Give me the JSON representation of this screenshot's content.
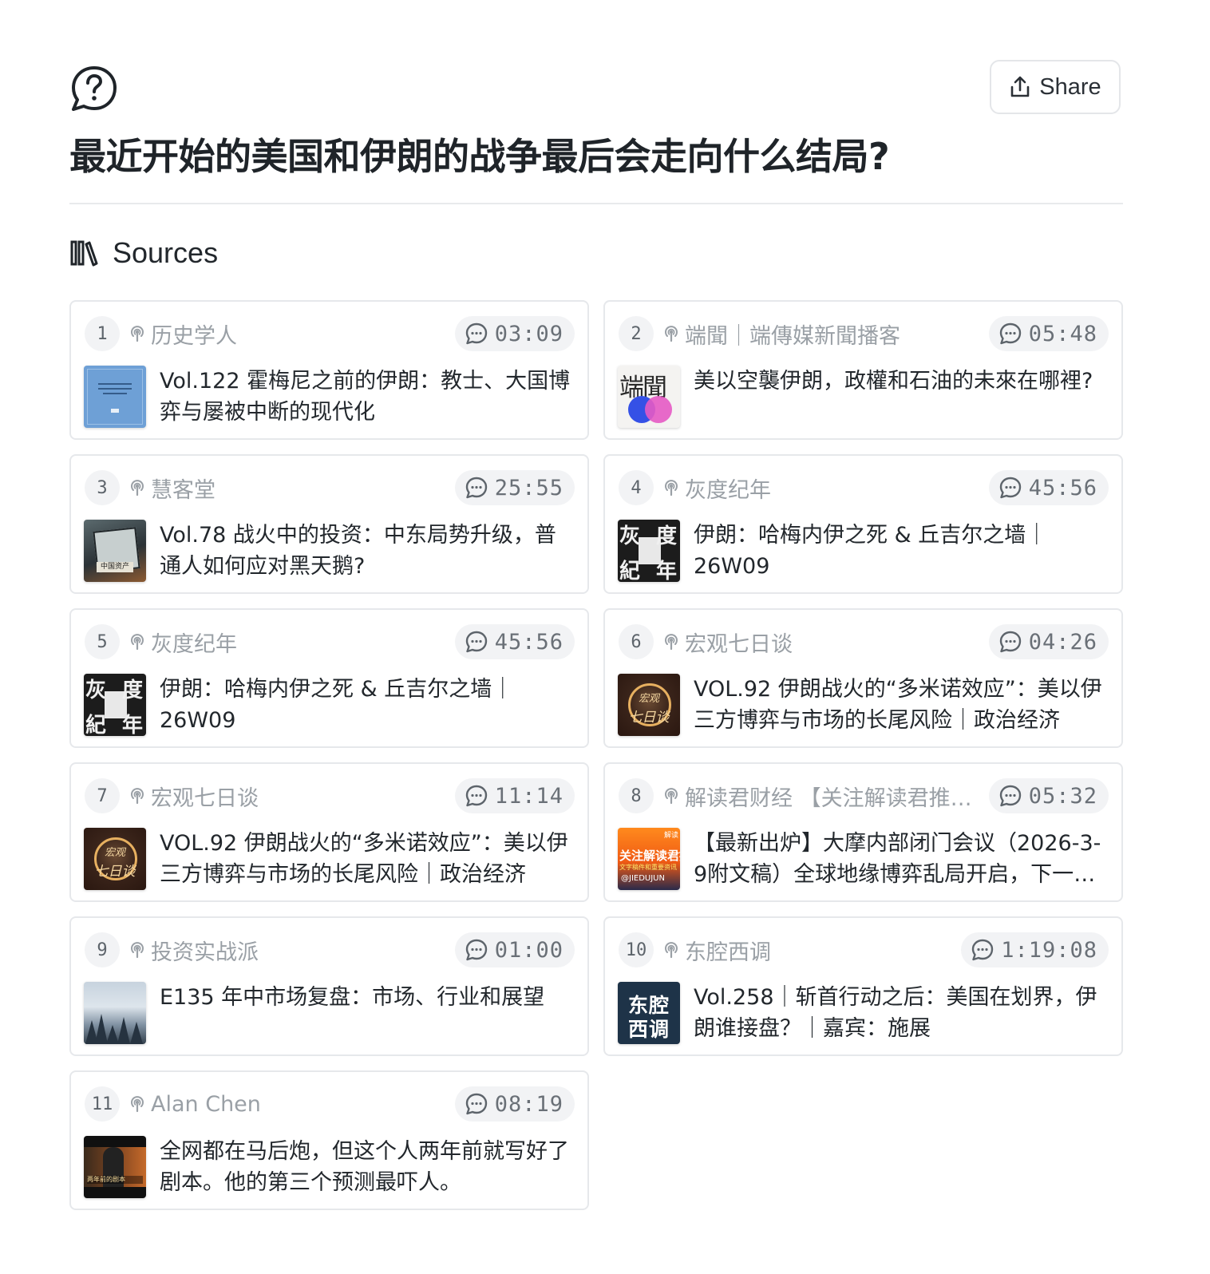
{
  "header": {
    "title": "最近开始的美国和伊朗的战争最后会走向什么结局?",
    "share_label": "Share",
    "question_icon": "question-chat-icon",
    "share_icon": "share-upload-icon"
  },
  "sources_section": {
    "label": "Sources",
    "icon": "library-books-icon"
  },
  "sources": [
    {
      "num": "1",
      "source": "历史学人",
      "duration": "03:09",
      "title": "Vol.122 霍梅尼之前的伊朗：教士、大国博弈与屡被中断的现代化",
      "thumb": "book-cover-blue"
    },
    {
      "num": "2",
      "source": "端聞｜端傳媒新聞播客",
      "duration": "05:48",
      "title": "美以空襲伊朗，政權和石油的未來在哪裡?",
      "thumb": "duan-logo",
      "thumb_text": "端聞"
    },
    {
      "num": "3",
      "source": "慧客堂",
      "duration": "25:55",
      "title": "Vol.78 战火中的投资：中东局势升级，普通人如何应对黑天鹅?",
      "thumb": "illustration-war-investing",
      "thumb_text": "中国资产"
    },
    {
      "num": "4",
      "source": "灰度纪年",
      "duration": "45:56",
      "title": "伊朗：哈梅内伊之死 & 丘吉尔之墙｜26W09",
      "thumb": "huidu-logo",
      "thumb_text": [
        "灰",
        "度",
        "紀",
        "年"
      ]
    },
    {
      "num": "5",
      "source": "灰度纪年",
      "duration": "45:56",
      "title": "伊朗：哈梅内伊之死 & 丘吉尔之墙｜26W09",
      "thumb": "huidu-logo",
      "thumb_text": [
        "灰",
        "度",
        "紀",
        "年"
      ]
    },
    {
      "num": "6",
      "source": "宏观七日谈",
      "duration": "04:26",
      "title": "VOL.92 伊朗战火的“多米诺效应”：美以伊三方博弈与市场的长尾风险｜政治经济",
      "thumb": "hongguan-logo",
      "thumb_text": [
        "宏观",
        "七日谈"
      ]
    },
    {
      "num": "7",
      "source": "宏观七日谈",
      "duration": "11:14",
      "title": "VOL.92 伊朗战火的“多米诺效应”：美以伊三方博弈与市场的长尾风险｜政治经济",
      "thumb": "hongguan-logo",
      "thumb_text": [
        "宏观",
        "七日谈"
      ]
    },
    {
      "num": "8",
      "source": "解读君财经 【关注解读君推特】",
      "duration": "05:32",
      "title": "【最新出炉】大摩内部闭门会议（2026-3-9附文稿）全球地缘博弈乱局开启，下一步资金流向何方",
      "thumb": "jiedu-cover",
      "thumb_text": [
        "解读",
        "关注解读君推特",
        "文字稿件和重要资讯",
        "@JIEDUJUN"
      ]
    },
    {
      "num": "9",
      "source": "投资实战派",
      "duration": "01:00",
      "title": "E135 年中市场复盘：市场、行业和展望",
      "thumb": "misty-forest"
    },
    {
      "num": "10",
      "source": "东腔西调",
      "duration": "1:19:08",
      "title": "Vol.258｜斩首行动之后：美国在划界，伊朗谁接盘？｜嘉宾：施展",
      "thumb": "dongqiang-logo",
      "thumb_text": [
        "东腔",
        "西调"
      ]
    },
    {
      "num": "11",
      "source": "Alan Chen",
      "duration": "08:19",
      "title": "全网都在马后炮，但这个人两年前就写好了剧本。他的第三个预测最吓人。",
      "thumb": "video-still",
      "thumb_text": "两年前的剧本"
    }
  ]
}
